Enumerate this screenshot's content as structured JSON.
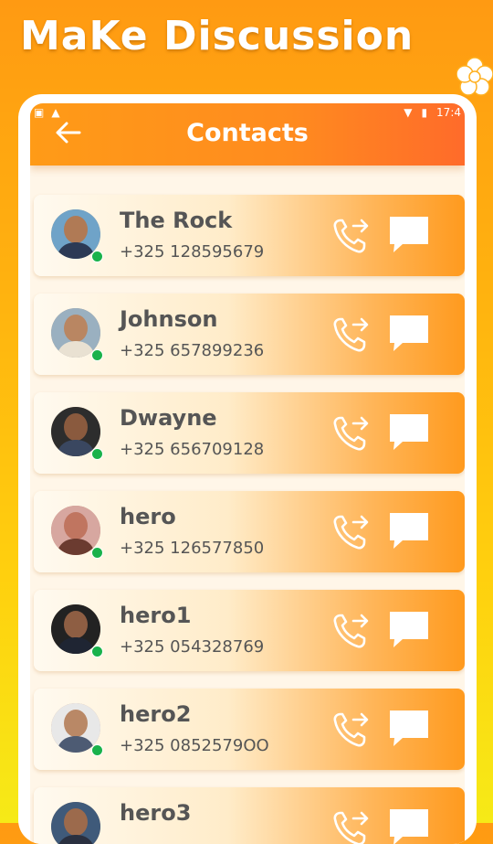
{
  "promo": {
    "title": "MaKe Discussion"
  },
  "status_bar": {
    "time": "17:4"
  },
  "header": {
    "title": "Contacts"
  },
  "contacts": [
    {
      "name": "The Rock",
      "phone": "+325 128595679",
      "online": true
    },
    {
      "name": "Johnson",
      "phone": "+325 657899236",
      "online": true
    },
    {
      "name": "Dwayne",
      "phone": "+325 656709128",
      "online": true
    },
    {
      "name": "hero",
      "phone": "+325 126577850",
      "online": true
    },
    {
      "name": "hero1",
      "phone": "+325 054328769",
      "online": true
    },
    {
      "name": "hero2",
      "phone": "+325 0852579OO",
      "online": true
    },
    {
      "name": "hero3",
      "phone": "",
      "online": false
    }
  ],
  "icons": {
    "back": "arrow-left-icon",
    "call": "phone-forward-icon",
    "message": "chat-bubble-icon",
    "status": "online-dot-icon"
  },
  "colors": {
    "accent": "#ff8b1f",
    "online": "#19b24b",
    "text": "#555555"
  }
}
